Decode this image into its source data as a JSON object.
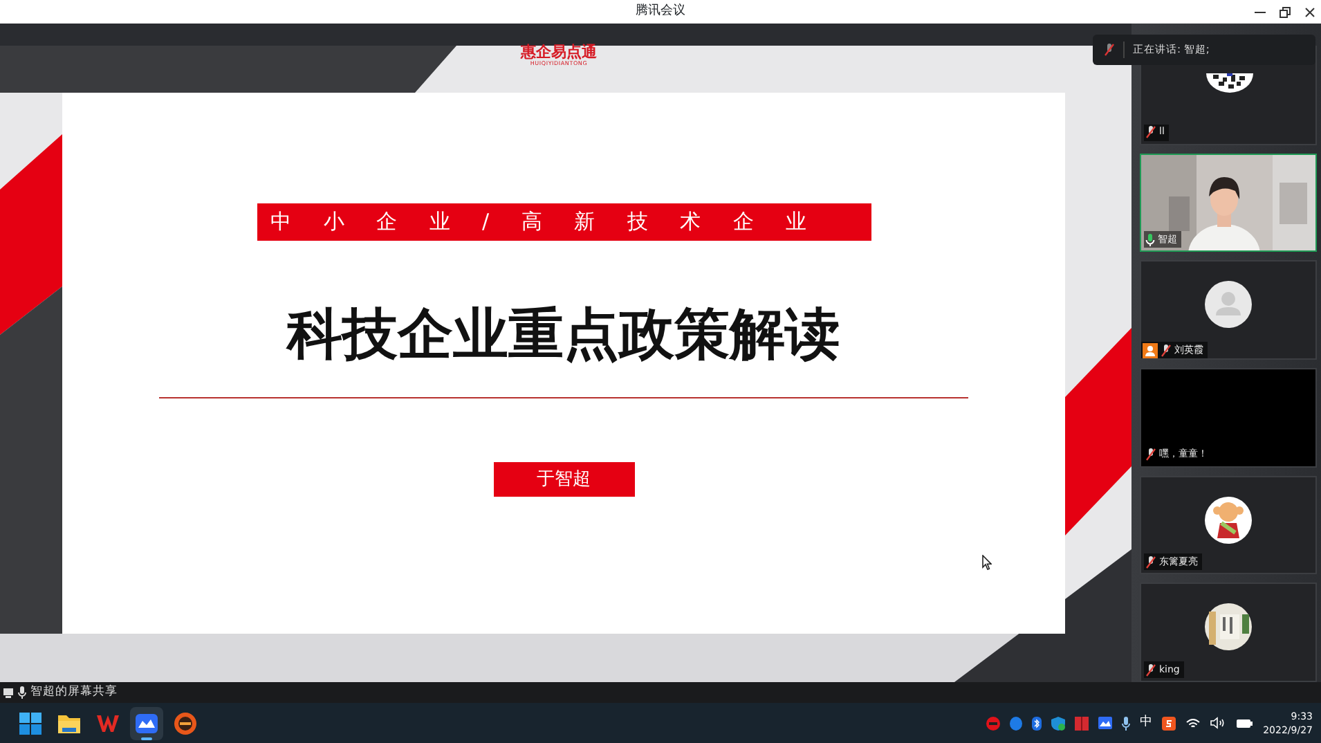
{
  "window": {
    "title": "腾讯会议"
  },
  "slide": {
    "logo": "惠企易点通",
    "logo_subtitle": "HUIQIYIDIANTONG",
    "tagline": "中小企业/高新技术企业",
    "title": "科技企业重点政策解读",
    "presenter": "于智超"
  },
  "speaking_notice": {
    "text": "正在讲话: 智超;"
  },
  "participants": [
    {
      "name": "ll",
      "kind": "qr",
      "muted": true,
      "speaking": false,
      "host": false
    },
    {
      "name": "智超",
      "kind": "video",
      "muted": false,
      "speaking": true,
      "host": false
    },
    {
      "name": "刘英霞",
      "kind": "default",
      "muted": true,
      "speaking": false,
      "host": true
    },
    {
      "name": "嘿，童童！",
      "kind": "blank",
      "muted": true,
      "speaking": false,
      "host": false
    },
    {
      "name": "东篱夏亮",
      "kind": "cartoon",
      "muted": true,
      "speaking": false,
      "host": false
    },
    {
      "name": "king",
      "muted": true,
      "speaking": false,
      "host": false
    }
  ],
  "share_bar": {
    "text": "智超的屏幕共享"
  },
  "taskbar": {
    "apps": [
      {
        "kind": "start",
        "active": false
      },
      {
        "kind": "folder",
        "active": false
      },
      {
        "kind": "office",
        "active": false
      },
      {
        "kind": "meeting",
        "active": true
      },
      {
        "kind": "orange",
        "active": false
      }
    ],
    "tray": {
      "ime": "中",
      "time": "9:33",
      "date": "2022/9/27"
    }
  }
}
